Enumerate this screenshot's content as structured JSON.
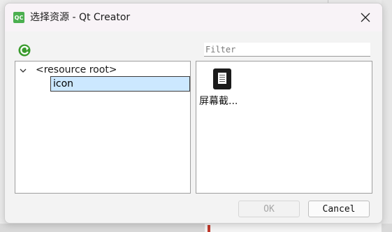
{
  "window": {
    "title": "选择资源 - Qt Creator",
    "app_icon_text": "QC"
  },
  "toolbar": {
    "reload_icon": "refresh-icon",
    "filter_placeholder": "Filter",
    "filter_value": ""
  },
  "tree": {
    "root_label": "<resource root>",
    "children": [
      {
        "label": "icon",
        "selected": true
      }
    ]
  },
  "files": [
    {
      "label": "屏幕截...",
      "icon": "document-icon"
    }
  ],
  "buttons": {
    "ok_label": "OK",
    "ok_enabled": false,
    "cancel_label": "Cancel"
  },
  "colors": {
    "selection": "#cce8ff",
    "reload_green": "#3a9b2d",
    "qt_green": "#4caf50"
  }
}
